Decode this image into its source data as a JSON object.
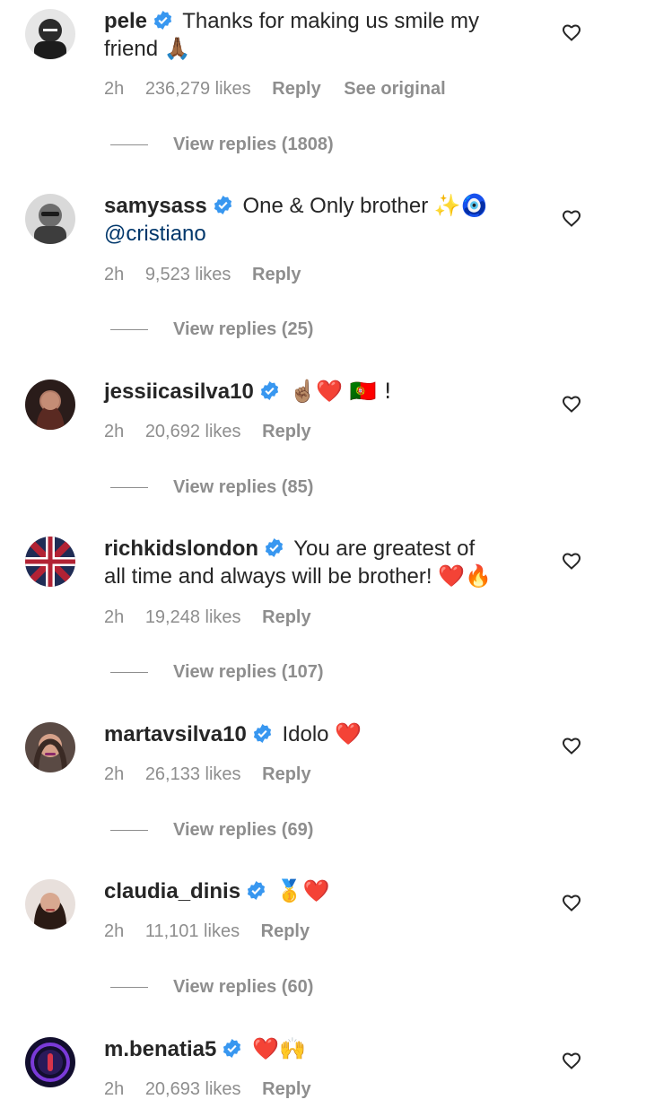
{
  "comments": [
    {
      "user": "pele",
      "text": "Thanks for making us smile my friend 🙏🏾",
      "mention": "",
      "time": "2h",
      "likes": "236,279 likes",
      "reply_label": "Reply",
      "extra_label": "See original",
      "view_replies": "View replies (1808)",
      "avatar_color": "#3a3a3a"
    },
    {
      "user": "samysass",
      "text": "One & Only brother ✨🧿",
      "mention": "@cristiano",
      "time": "2h",
      "likes": "9,523 likes",
      "reply_label": "Reply",
      "extra_label": "",
      "view_replies": "View replies (25)",
      "avatar_color": "#555555"
    },
    {
      "user": "jessiicasilva10",
      "text": "☝🏽❤️ 🇵🇹 !",
      "mention": "",
      "time": "2h",
      "likes": "20,692 likes",
      "reply_label": "Reply",
      "extra_label": "",
      "view_replies": "View replies (85)",
      "avatar_color": "#4a2a25"
    },
    {
      "user": "richkidslondon",
      "text": "You are greatest of all time and always will be brother! ❤️🔥",
      "mention": "",
      "time": "2h",
      "likes": "19,248 likes",
      "reply_label": "Reply",
      "extra_label": "",
      "view_replies": "View replies (107)",
      "avatar_color": "#23325a"
    },
    {
      "user": "martavsilva10",
      "text": "Idolo ❤️",
      "mention": "",
      "time": "2h",
      "likes": "26,133 likes",
      "reply_label": "Reply",
      "extra_label": "",
      "view_replies": "View replies (69)",
      "avatar_color": "#7a5a4a"
    },
    {
      "user": "claudia_dinis",
      "text": "🥇❤️",
      "mention": "",
      "time": "2h",
      "likes": "11,101 likes",
      "reply_label": "Reply",
      "extra_label": "",
      "view_replies": "View replies (60)",
      "avatar_color": "#6a4a3a"
    },
    {
      "user": "m.benatia5",
      "text": "❤️🙌",
      "mention": "",
      "time": "2h",
      "likes": "20,693 likes",
      "reply_label": "Reply",
      "extra_label": "",
      "view_replies": "",
      "avatar_color": "#1a1440"
    }
  ],
  "colors": {
    "text": "#262626",
    "meta": "#8e8e8e",
    "verified": "#3897f0",
    "mention": "#00376b"
  },
  "icons": {
    "verified": "verified-badge-icon",
    "like": "heart-outline-icon"
  }
}
